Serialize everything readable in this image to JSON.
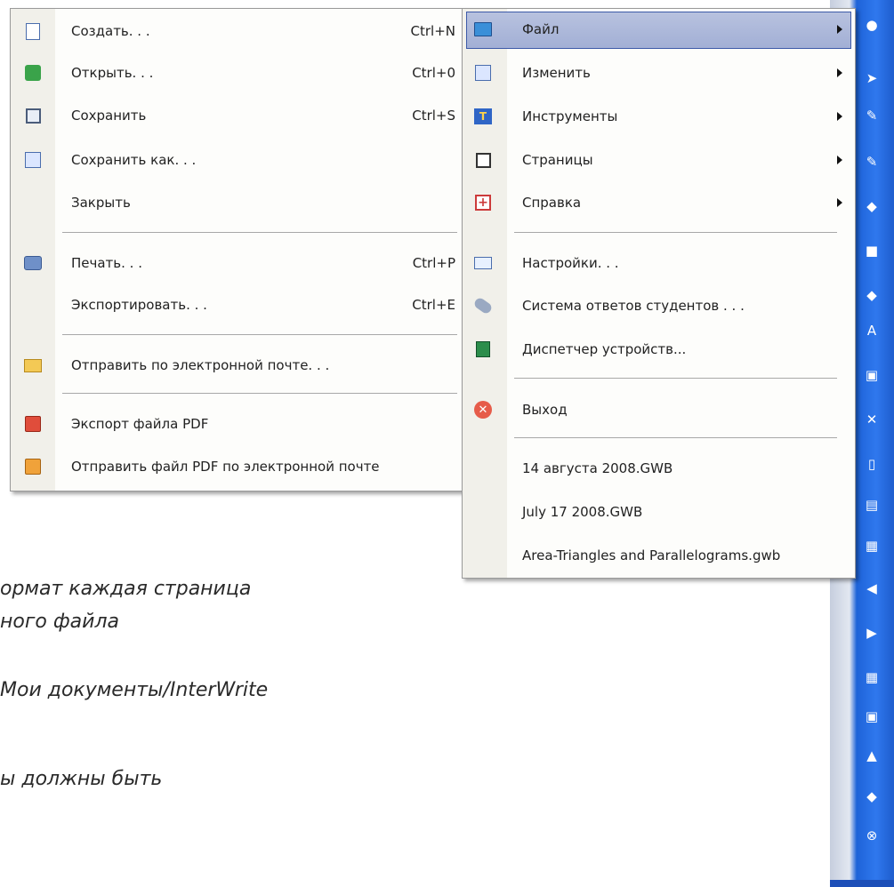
{
  "background_text": {
    "line1": "ормат каждая страница",
    "line2": "ного файла",
    "line3": "Мои документы/InterWrite",
    "line4": "ы должны быть"
  },
  "file_submenu": {
    "items": [
      {
        "label": "Создать. . .",
        "shortcut": "Ctrl+N",
        "icon": "new-document-icon"
      },
      {
        "label": "Открыть. . .",
        "shortcut": "Ctrl+0",
        "icon": "open-folder-icon"
      },
      {
        "label": "Сохранить",
        "shortcut": "Ctrl+S",
        "icon": "save-floppy-icon"
      },
      {
        "label": "Сохранить как. . .",
        "shortcut": "",
        "icon": "save-as-icon"
      },
      {
        "label": "Закрыть",
        "shortcut": "",
        "icon": ""
      },
      {
        "label": "Печать. . .",
        "shortcut": "Ctrl+P",
        "icon": "printer-icon"
      },
      {
        "label": "Экспортировать. . .",
        "shortcut": "Ctrl+E",
        "icon": ""
      },
      {
        "label": "Отправить по электронной почте. . .",
        "shortcut": "",
        "icon": "mail-icon"
      },
      {
        "label": "Экспорт файла PDF",
        "shortcut": "",
        "icon": "pdf-export-icon"
      },
      {
        "label": "Отправить файл PDF по электронной почте",
        "shortcut": "",
        "icon": "pdf-mail-icon"
      }
    ]
  },
  "main_menu": {
    "items": [
      {
        "label": "Файл",
        "has_submenu": true,
        "selected": true,
        "icon": "folder-icon"
      },
      {
        "label": "Изменить",
        "has_submenu": true,
        "icon": "edit-pencil-icon"
      },
      {
        "label": "Инструменты",
        "has_submenu": true,
        "icon": "tools-icon"
      },
      {
        "label": "Страницы",
        "has_submenu": true,
        "icon": "pages-icon"
      },
      {
        "label": "Справка",
        "has_submenu": true,
        "icon": "help-icon"
      },
      {
        "label": "Настройки. . .",
        "has_submenu": false,
        "icon": "settings-icon"
      },
      {
        "label": "Система ответов студентов . . .",
        "has_submenu": false,
        "icon": "remote-icon"
      },
      {
        "label": "Диспетчер устройств...",
        "has_submenu": false,
        "icon": "device-manager-icon"
      },
      {
        "label": "Выход",
        "has_submenu": false,
        "icon": "exit-icon"
      },
      {
        "label": "14 августа 2008.GWB",
        "has_submenu": false,
        "icon": ""
      },
      {
        "label": "July 17 2008.GWB",
        "has_submenu": false,
        "icon": ""
      },
      {
        "label": "Area-Triangles and Parallelograms.gwb",
        "has_submenu": false,
        "icon": ""
      }
    ]
  },
  "colors": {
    "highlight": "#a9b5d8",
    "toolbar_blue": "#2f78ee",
    "menu_bg": "#fdfdfb"
  }
}
